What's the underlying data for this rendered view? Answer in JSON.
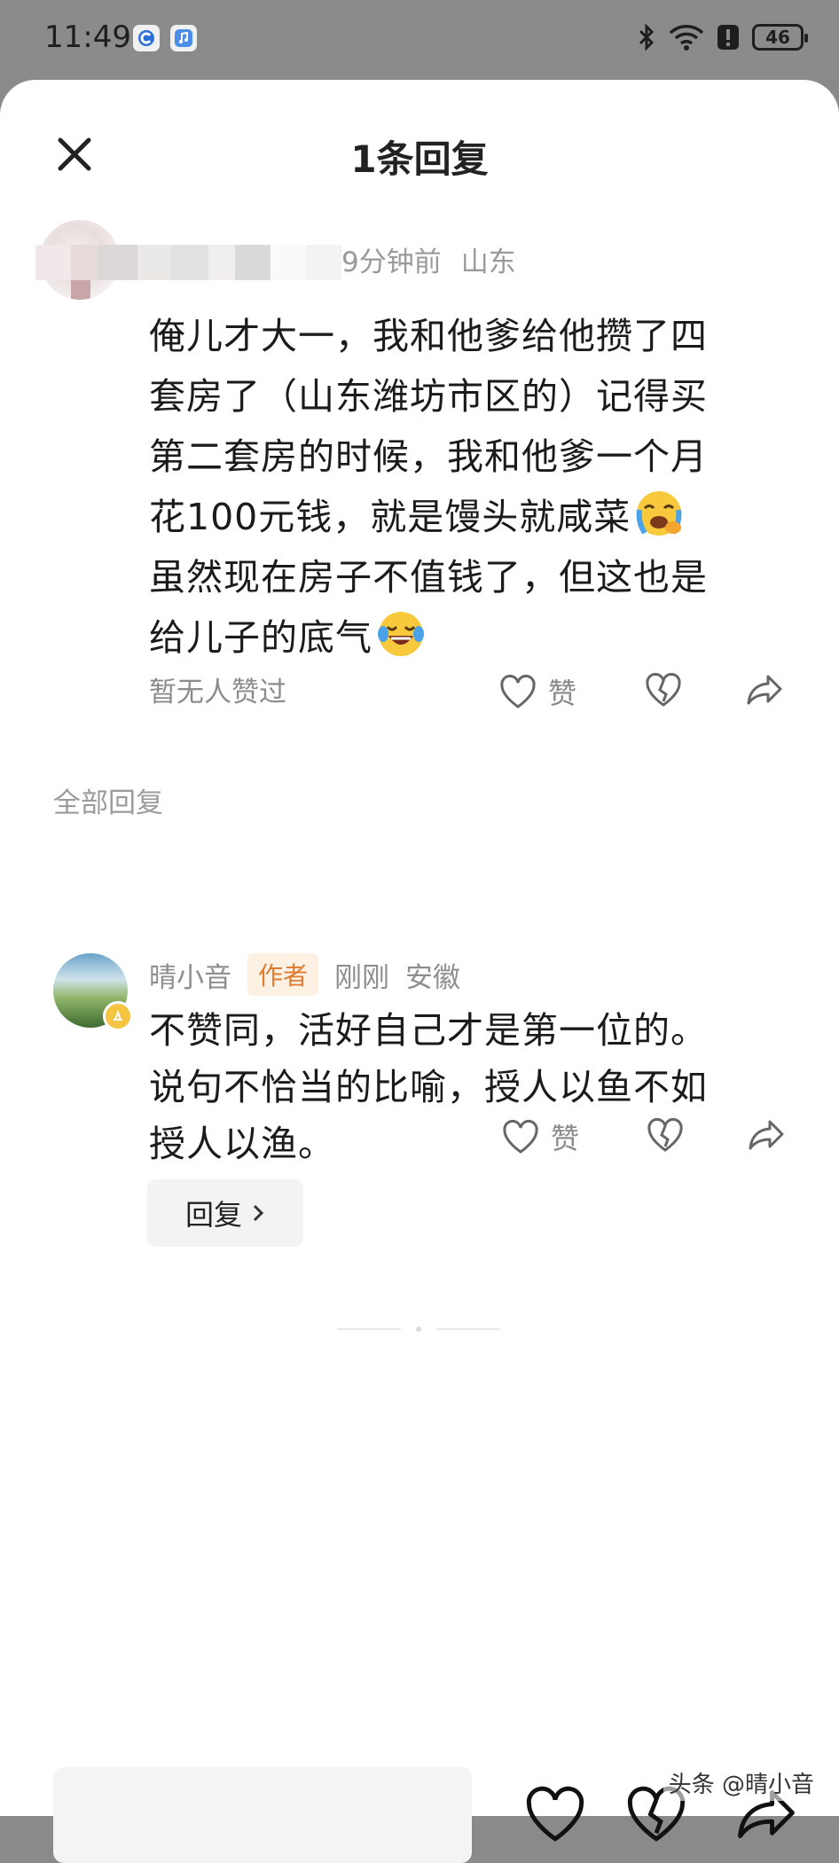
{
  "status_bar": {
    "time": "11:49",
    "battery_level": "46",
    "icons": [
      "bluetooth-icon",
      "wifi-icon",
      "alert-icon",
      "battery-icon"
    ]
  },
  "sheet": {
    "title": "1条回复",
    "close_icon": "close-icon"
  },
  "main_comment": {
    "time": "9分钟前",
    "location": "山东",
    "text_line1": "俺儿才大一，我和他爹给他攒了四",
    "text_line2": "套房了（山东潍坊市区的）记得买",
    "text_line3": "第二套房的时候，我和他爹一个月",
    "text_line4": "花100元钱，就是馒头就咸菜",
    "text_line5": "虽然现在房子不值钱了，但这也是",
    "text_line6": "给儿子的底气",
    "likes_status": "暂无人赞过",
    "like_label": "赞"
  },
  "replies_section": {
    "label": "全部回复"
  },
  "reply": {
    "username": "晴小音",
    "author_tag": "作者",
    "time": "刚刚",
    "location": "安徽",
    "text_line1": "不赞同，活好自己才是第一位的。",
    "text_line2": "说句不恰当的比喻，授人以鱼不如",
    "text_line3": "授人以渔。",
    "reply_button": "回复",
    "like_label": "赞"
  },
  "watermark": "头条 @晴小音",
  "colors": {
    "accent_tag_text": "#e07a2e",
    "accent_tag_bg": "#fdf1e4",
    "overlay": "#8a8a8a"
  }
}
